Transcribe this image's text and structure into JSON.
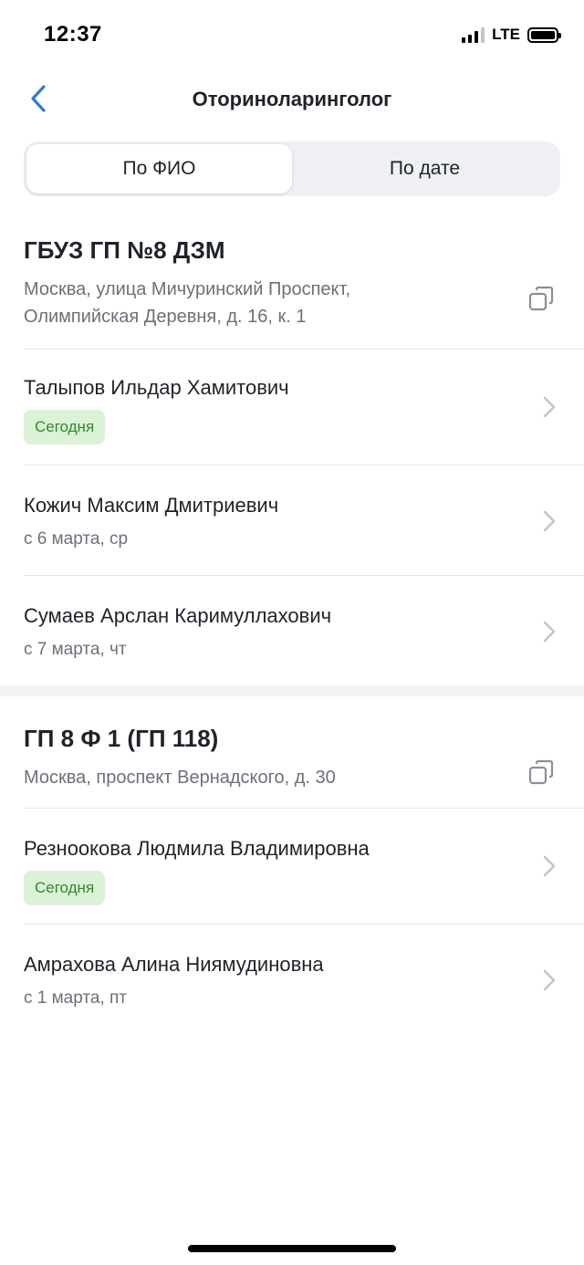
{
  "status_bar": {
    "time": "12:37",
    "network": "LTE"
  },
  "nav": {
    "title": "Оториноларинголог"
  },
  "tabs": [
    {
      "label": "По ФИО",
      "active": true
    },
    {
      "label": "По дате",
      "active": false
    }
  ],
  "clinics": [
    {
      "name": "ГБУЗ ГП №8 ДЗМ",
      "address": "Москва, улица Мичуринский Проспект, Олимпийская Деревня, д. 16, к. 1",
      "doctors": [
        {
          "name": "Талыпов Ильдар Хамитович",
          "availability": "Сегодня",
          "today": true
        },
        {
          "name": "Кожич Максим Дмитриевич",
          "availability": "с 6 марта, ср",
          "today": false
        },
        {
          "name": "Сумаев Арслан Каримуллахович",
          "availability": "с 7 марта, чт",
          "today": false
        }
      ]
    },
    {
      "name": "ГП 8 Ф 1 (ГП 118)",
      "address": "Москва, проспект Вернадского, д. 30",
      "doctors": [
        {
          "name": "Резноокова Людмила Владимировна",
          "availability": "Сегодня",
          "today": true
        },
        {
          "name": "Амрахова Алина Ниямудиновна",
          "availability": "с 1 марта, пт",
          "today": false
        }
      ]
    }
  ],
  "colors": {
    "accent": "#2f7bd6",
    "badge_bg": "#dbf2d7",
    "badge_text": "#2e8a2c",
    "secondary_text": "#6b7079"
  },
  "icons": {
    "back": "chevron-left-icon",
    "copy": "copy-icon",
    "row": "chevron-right-icon"
  }
}
